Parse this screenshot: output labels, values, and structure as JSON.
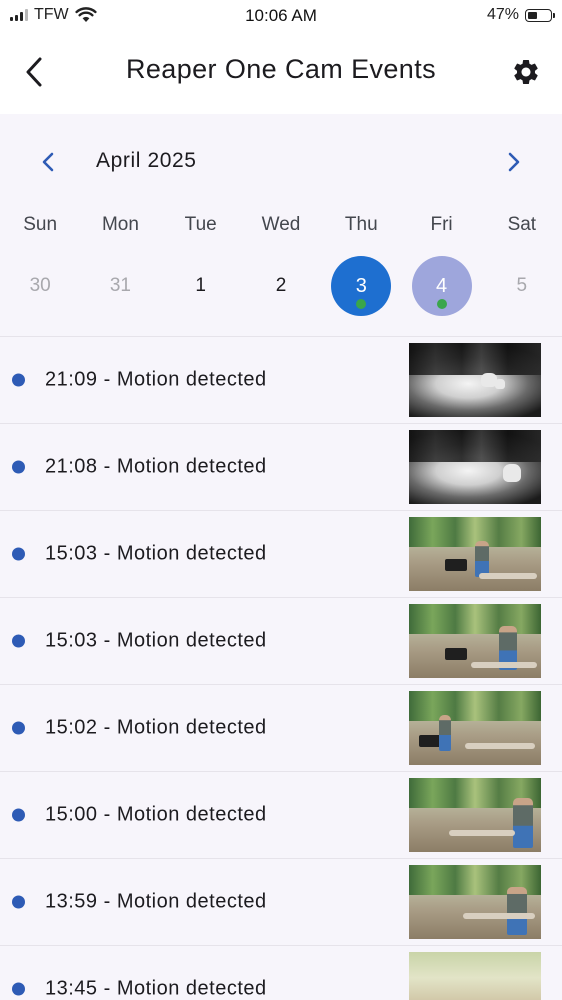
{
  "status_bar": {
    "carrier": "TFW",
    "time": "10:06 AM",
    "battery_percent": "47%",
    "battery_level": 0.47
  },
  "app_bar": {
    "title": "Reaper One Cam Events",
    "back_icon": "chevron-left-icon",
    "settings_icon": "gear-icon"
  },
  "calendar": {
    "month_label": "April 2025",
    "prev_icon": "chevron-left-icon",
    "next_icon": "chevron-right-icon",
    "weekdays": [
      "Sun",
      "Mon",
      "Tue",
      "Wed",
      "Thu",
      "Fri",
      "Sat"
    ],
    "days": [
      {
        "label": "30",
        "state": "outside-month"
      },
      {
        "label": "31",
        "state": "outside-month"
      },
      {
        "label": "1",
        "state": "in-month"
      },
      {
        "label": "2",
        "state": "in-month"
      },
      {
        "label": "3",
        "state": "selected",
        "has_events": true
      },
      {
        "label": "4",
        "state": "today",
        "has_events": true
      },
      {
        "label": "5",
        "state": "outside-month"
      }
    ],
    "colors": {
      "selected": "#1e6fd0",
      "today": "#9ea6dc",
      "event_marker": "#3aa64b"
    }
  },
  "events": [
    {
      "text": "21:09 - Motion detected",
      "thumbnail": "night-infrared"
    },
    {
      "text": "21:08 - Motion detected",
      "thumbnail": "night-infrared"
    },
    {
      "text": "15:03 - Motion detected",
      "thumbnail": "daylight"
    },
    {
      "text": "15:03 - Motion detected",
      "thumbnail": "daylight"
    },
    {
      "text": "15:02 - Motion detected",
      "thumbnail": "daylight"
    },
    {
      "text": "15:00 - Motion detected",
      "thumbnail": "daylight"
    },
    {
      "text": "13:59 - Motion detected",
      "thumbnail": "daylight"
    },
    {
      "text": "13:45 - Motion detected",
      "thumbnail": "daylight-bright"
    }
  ],
  "colors": {
    "event_dot": "#2e5bb5",
    "background": "#f7f5fb"
  }
}
